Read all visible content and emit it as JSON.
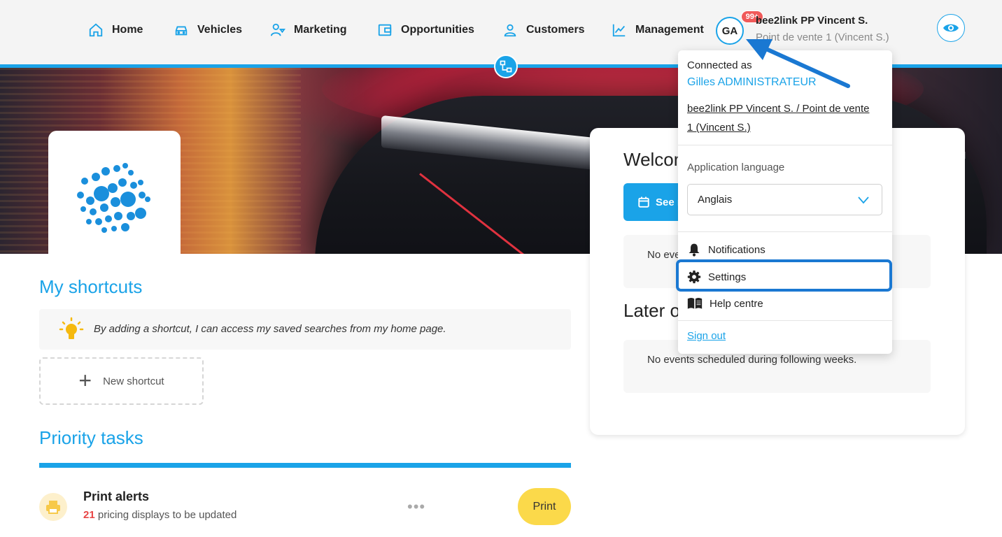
{
  "nav": {
    "items": [
      {
        "id": "home",
        "label": "Home",
        "icon": "home-icon"
      },
      {
        "id": "vehicles",
        "label": "Vehicles",
        "icon": "car-icon"
      },
      {
        "id": "marketing",
        "label": "Marketing",
        "icon": "marketing-icon"
      },
      {
        "id": "opportunities",
        "label": "Opportunities",
        "icon": "wallet-icon"
      },
      {
        "id": "customers",
        "label": "Customers",
        "icon": "person-icon"
      },
      {
        "id": "management",
        "label": "Management",
        "icon": "chart-line-icon"
      }
    ]
  },
  "account": {
    "initials": "GA",
    "badge": "99+",
    "name": "bee2link PP Vincent S.",
    "point_of_sale": "Point de vente 1 (Vincent S.)"
  },
  "dropdown": {
    "connected_label": "Connected as",
    "user": "Gilles ADMINISTRATEUR",
    "org_line1": "bee2link PP Vincent S. / Point de vente",
    "org_line2": "1 (Vincent S.)",
    "language_label": "Application language",
    "language_value": "Anglais",
    "notifications": "Notifications",
    "settings": "Settings",
    "help": "Help centre",
    "sign_out": "Sign out"
  },
  "shortcuts": {
    "title": "My shortcuts",
    "tip": "By adding a shortcut, I can access my saved searches from my home page.",
    "new_label": "New shortcut"
  },
  "priority": {
    "title": "Priority tasks",
    "task": {
      "title": "Print alerts",
      "count": "21",
      "suffix": " pricing displays to be updated",
      "dots": "•••",
      "button": "Print"
    }
  },
  "welcome": {
    "title": "Welcom",
    "see_button": "See m",
    "today_events": "No eve",
    "later_title": "Later o",
    "later_events": "No events scheduled during following weeks."
  },
  "colors": {
    "accent": "#1aa3e8",
    "highlight": "#1a78d2",
    "badge": "#f05a5a",
    "print_button": "#fbd94a"
  }
}
